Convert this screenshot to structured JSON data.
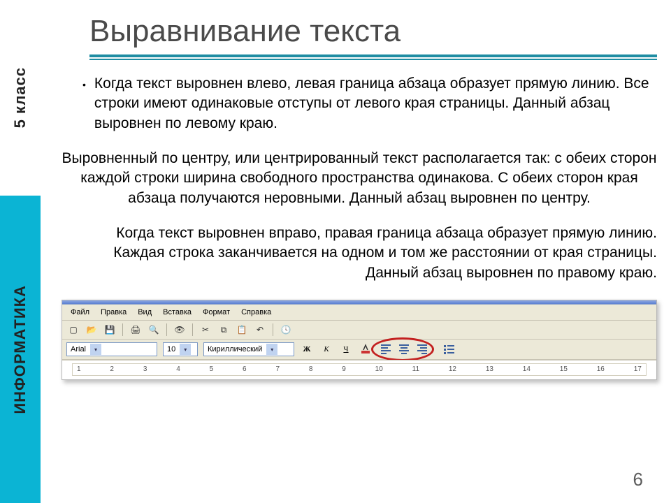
{
  "sidebar": {
    "grade_label": "5 класс",
    "subject_label": "ИНФОРМАТИКА"
  },
  "title": "Выравнивание текста",
  "placeholder_glyph": "",
  "paragraphs": {
    "left": "Когда текст выровнен влево, левая граница абзаца образует прямую линию. Все строки имеют одинаковые отступы от левого края страницы. Данный абзац выровнен по левому краю.",
    "center": "Выровненный по центру, или центрированный текст располагается так: с обеих сторон каждой строки ширина свободного пространства одинакова. С обеих сторон края абзаца получаются  неровными. Данный абзац выровнен по центру.",
    "right": "Когда текст выровнен вправо, правая граница абзаца образует прямую линию. Каждая строка заканчивается на одном и том же расстоянии от края страницы. Данный абзац выровнен по правому краю."
  },
  "toolbar": {
    "menus": [
      "Файл",
      "Правка",
      "Вид",
      "Вставка",
      "Формат",
      "Справка"
    ],
    "font_name": "Arial",
    "font_size": "10",
    "charset": "Кириллический",
    "bold": "Ж",
    "italic": "К",
    "underline": "Ч",
    "ruler_marks": [
      "1",
      "2",
      "3",
      "4",
      "5",
      "6",
      "7",
      "8",
      "9",
      "10",
      "11",
      "12",
      "13",
      "14",
      "15",
      "16",
      "17"
    ]
  },
  "page_number": "6"
}
